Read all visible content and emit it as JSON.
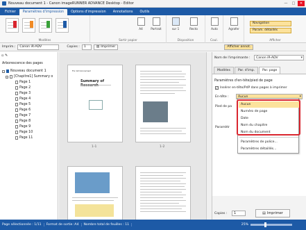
{
  "window": {
    "title": "Nouveau document 1 - Canon imageRUNNER ADVANCE Desktop - Editor",
    "min": "—",
    "max": "□",
    "close": "✕"
  },
  "tabs": [
    "Fichier",
    "Paramètres d'impression",
    "Options d'impression",
    "Annotations",
    "Outils"
  ],
  "ribbon": {
    "groups": [
      "Modèles",
      "Sortir papier",
      "Disposition",
      "Coul.",
      "Afficher"
    ],
    "portrait": "Portrait",
    "recto": "Recto",
    "auto": "Auto",
    "agrafer": "Agrafer",
    "a4": "A4",
    "sur1": "sur 1",
    "one": "1",
    "navigation": "Navigation",
    "favorites": "Param. détaillés",
    "colors": {
      "red": "#d9252e",
      "orange": "#f08a24",
      "green": "#3aa13a",
      "blue": "#1d5aa6"
    }
  },
  "toolbar": {
    "printer_label": "Imprim.:",
    "printer": "Canon iR-ADV",
    "copies_label": "Copies :",
    "copies": "1",
    "print": "Imprimer",
    "annot": "Afficher annot."
  },
  "left": {
    "title": "Arborescence des pages",
    "root": "Nouveau document 1",
    "chapter": "[Chapitre1] Summary o",
    "pages": [
      "Page 1",
      "Page 2",
      "Page 3",
      "Page 4",
      "Page 5",
      "Page 6",
      "Page 7",
      "Page 8",
      "Page 9",
      "Page 10",
      "Page 11"
    ]
  },
  "center": {
    "p1": "1-1",
    "p2": "1-2",
    "doc_title": "Summary of Research",
    "for_all": "For All Concerned"
  },
  "right": {
    "printer_label": "Nom de l'imprimante :",
    "printer": "Canon iR-ADV",
    "tabs": [
      "Modèles",
      "Par. d'imp.",
      "Par. page"
    ],
    "section": "Paramètres d'en-tête/pied de page",
    "chk": "Insérer en-tête/PdP dans pages à imprimer",
    "entete": "En-tête :",
    "entete_val": "Aucun",
    "pied": "Pied de pa",
    "param": "Paramètr",
    "copies_label": "Copies :",
    "copies": "1",
    "print": "Imprimer"
  },
  "dropdown": {
    "items": [
      "Aucun",
      "Numéro de page",
      "Date",
      "Nom du chapitre",
      "Nom du document"
    ],
    "extra": [
      "Paramètres de police...",
      "Paramètres détaillés..."
    ]
  },
  "status": {
    "selected": "Page sélectionnée : 1/11",
    "format": "Format de sortie :A4",
    "sheets": "Nombre total de feuilles : 11",
    "zoom": "25%"
  }
}
